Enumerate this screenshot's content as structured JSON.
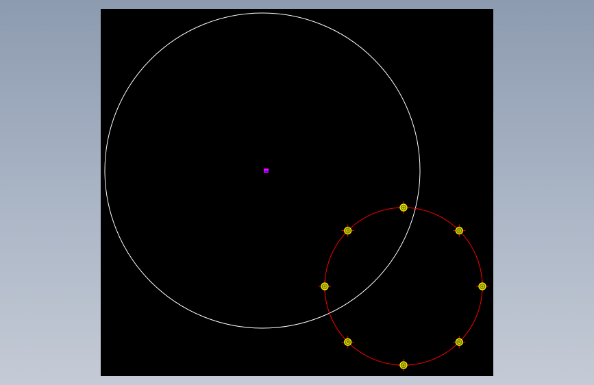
{
  "drawing": {
    "background_color": "#000000",
    "frame_color_top": "#8d9bb0",
    "frame_color_bottom": "#c5cbd6",
    "large_circle": {
      "color": "#ffffff"
    },
    "bolt_circle": {
      "color": "#ff0000",
      "hole_count": 8
    },
    "holes": {
      "fill": "#808000",
      "outline": "#ffff00",
      "center_mark_color": "#ff0000"
    },
    "origin_marker": {
      "color": "#ff00ff",
      "icon": "ucs-origin-icon"
    }
  }
}
